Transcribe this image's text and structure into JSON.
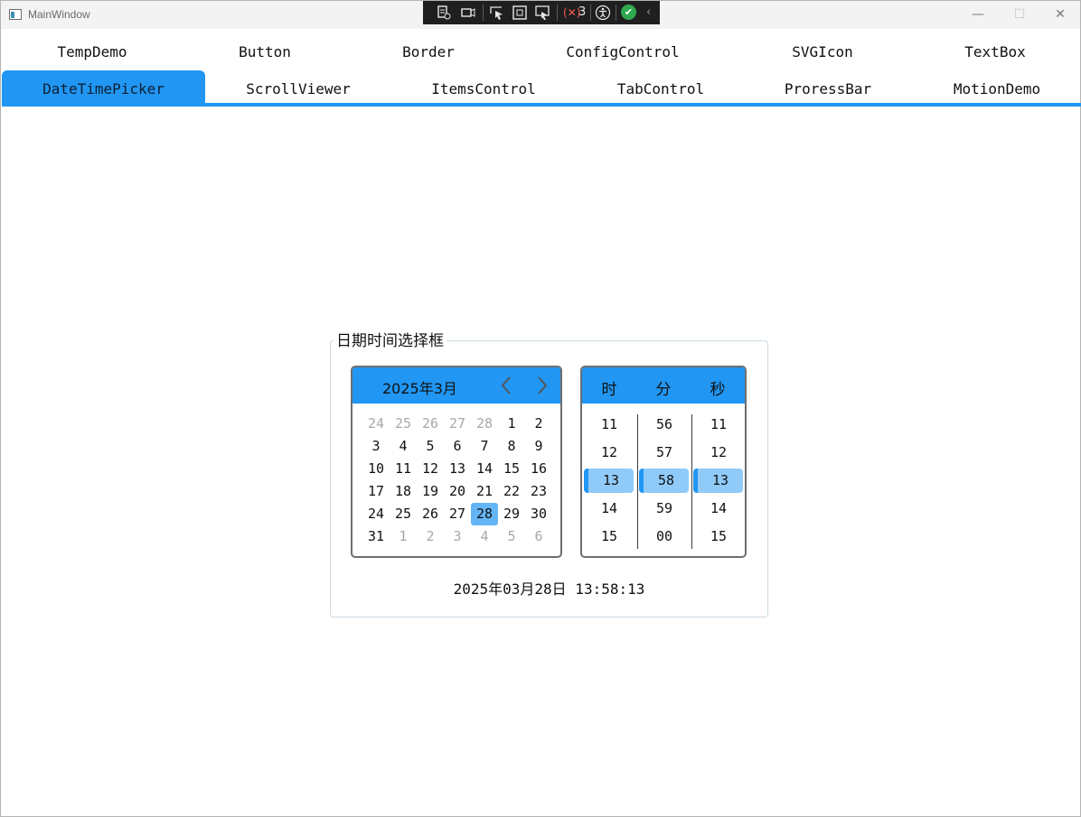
{
  "window": {
    "title": "MainWindow",
    "controls": {
      "minimize": "—",
      "maximize": "☐",
      "close": "✕"
    }
  },
  "debug_toolbar": {
    "icons": [
      "live-visual-tree-icon",
      "record-icon",
      "select-element-icon",
      "display-layout-adorners-icon",
      "track-focus-icon",
      "binding-failures-icon",
      "accessibility-icon",
      "hot-reload-ok-icon",
      "collapse-icon"
    ],
    "binding_failures": "3"
  },
  "tabs": {
    "row1": [
      "TempDemo",
      "Button",
      "Border",
      "ConfigControl",
      "SVGIcon",
      "TextBox"
    ],
    "row2": [
      "DateTimePicker",
      "ScrollViewer",
      "ItemsControl",
      "TabControl",
      "ProressBar",
      "MotionDemo"
    ],
    "active": "DateTimePicker"
  },
  "group": {
    "title": "日期时间选择框"
  },
  "calendar": {
    "title": "2025年3月",
    "prev_icon": "chevron-left-icon",
    "next_icon": "chevron-right-icon",
    "weeks": [
      [
        {
          "d": "24",
          "dim": true
        },
        {
          "d": "25",
          "dim": true
        },
        {
          "d": "26",
          "dim": true
        },
        {
          "d": "27",
          "dim": true
        },
        {
          "d": "28",
          "dim": true
        },
        {
          "d": "1"
        },
        {
          "d": "2"
        }
      ],
      [
        {
          "d": "3"
        },
        {
          "d": "4"
        },
        {
          "d": "5"
        },
        {
          "d": "6"
        },
        {
          "d": "7"
        },
        {
          "d": "8"
        },
        {
          "d": "9"
        }
      ],
      [
        {
          "d": "10"
        },
        {
          "d": "11"
        },
        {
          "d": "12"
        },
        {
          "d": "13"
        },
        {
          "d": "14"
        },
        {
          "d": "15"
        },
        {
          "d": "16"
        }
      ],
      [
        {
          "d": "17"
        },
        {
          "d": "18"
        },
        {
          "d": "19"
        },
        {
          "d": "20"
        },
        {
          "d": "21"
        },
        {
          "d": "22"
        },
        {
          "d": "23"
        }
      ],
      [
        {
          "d": "24"
        },
        {
          "d": "25"
        },
        {
          "d": "26"
        },
        {
          "d": "27"
        },
        {
          "d": "28",
          "selected": true
        },
        {
          "d": "29"
        },
        {
          "d": "30"
        }
      ],
      [
        {
          "d": "31"
        },
        {
          "d": "1",
          "dim": true
        },
        {
          "d": "2",
          "dim": true
        },
        {
          "d": "3",
          "dim": true
        },
        {
          "d": "4",
          "dim": true
        },
        {
          "d": "5",
          "dim": true
        },
        {
          "d": "6",
          "dim": true
        }
      ]
    ]
  },
  "timepicker": {
    "headers": [
      "时",
      "分",
      "秒"
    ],
    "columns": [
      {
        "values": [
          "11",
          "12",
          "13",
          "14",
          "15"
        ],
        "selected": "13"
      },
      {
        "values": [
          "56",
          "57",
          "58",
          "59",
          "00"
        ],
        "selected": "58"
      },
      {
        "values": [
          "11",
          "12",
          "13",
          "14",
          "15"
        ],
        "selected": "13"
      }
    ]
  },
  "result": {
    "text": "2025年03月28日 13:58:13"
  },
  "colors": {
    "accent": "#2196f3",
    "selected_day": "#64b5f6",
    "selected_time": "#90caf9"
  }
}
